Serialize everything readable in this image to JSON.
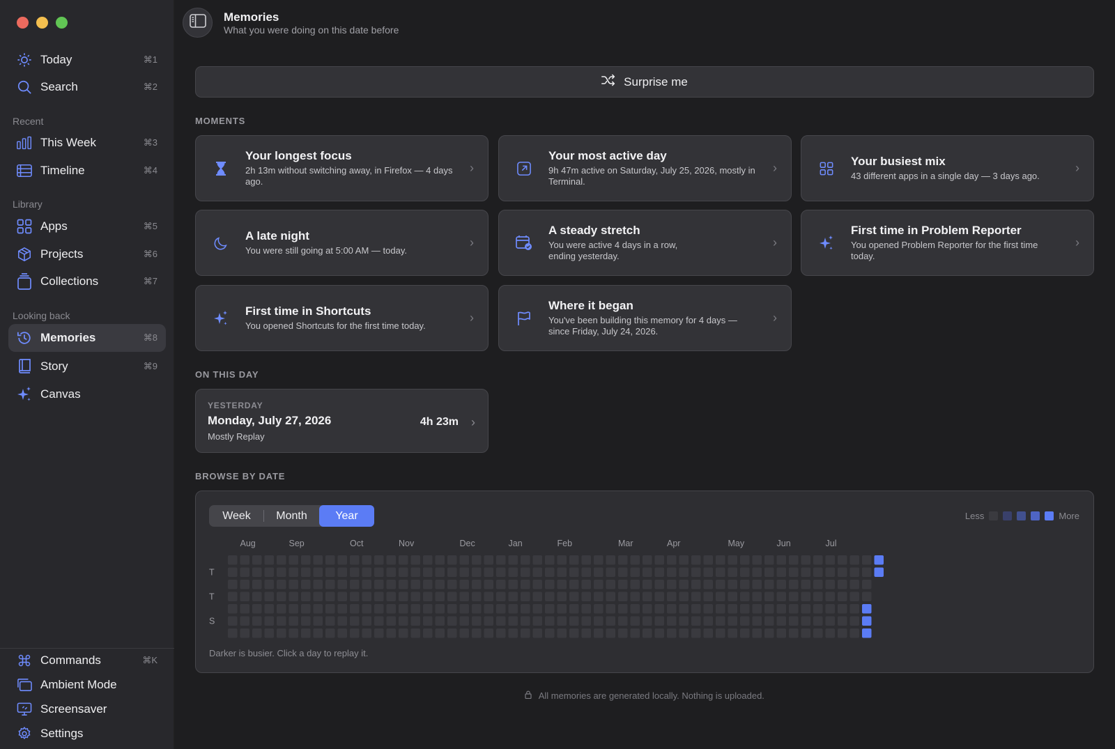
{
  "sidebar": {
    "nav_top": [
      {
        "label": "Today",
        "shortcut": "⌘1",
        "icon": "sun-icon"
      },
      {
        "label": "Search",
        "shortcut": "⌘2",
        "icon": "search-icon"
      }
    ],
    "recent_label": "Recent",
    "recent": [
      {
        "label": "This Week",
        "shortcut": "⌘3",
        "icon": "bar-chart-icon"
      },
      {
        "label": "Timeline",
        "shortcut": "⌘4",
        "icon": "timeline-icon"
      }
    ],
    "library_label": "Library",
    "library": [
      {
        "label": "Apps",
        "shortcut": "⌘5",
        "icon": "grid-icon"
      },
      {
        "label": "Projects",
        "shortcut": "⌘6",
        "icon": "box-icon"
      },
      {
        "label": "Collections",
        "shortcut": "⌘7",
        "icon": "stack-icon"
      }
    ],
    "looking_back_label": "Looking back",
    "looking_back": [
      {
        "label": "Memories",
        "shortcut": "⌘8",
        "icon": "history-icon",
        "active": true
      },
      {
        "label": "Story",
        "shortcut": "⌘9",
        "icon": "book-icon"
      },
      {
        "label": "Canvas",
        "shortcut": "",
        "icon": "sparkle-icon"
      }
    ],
    "bottom": [
      {
        "label": "Commands",
        "shortcut": "⌘K",
        "icon": "command-icon"
      },
      {
        "label": "Ambient Mode",
        "shortcut": "",
        "icon": "windows-icon"
      },
      {
        "label": "Screensaver",
        "shortcut": "",
        "icon": "monitor-icon"
      },
      {
        "label": "Settings",
        "shortcut": "",
        "icon": "gear-icon"
      }
    ]
  },
  "header": {
    "title": "Memories",
    "subtitle": "What you were doing on this date before"
  },
  "surprise_label": "Surprise me",
  "moments_header": "MOMENTS",
  "moments": [
    {
      "title": "Your longest focus",
      "desc": "2h 13m without switching away, in Firefox — 4 days ago.",
      "icon": "hourglass-icon"
    },
    {
      "title": "Your most active day",
      "desc": "9h 47m active on Saturday, July 25, 2026, mostly in Terminal.",
      "icon": "arrow-up-right-square-icon"
    },
    {
      "title": "Your busiest mix",
      "desc": "43 different apps in a single day — 3 days ago.",
      "icon": "grid-icon"
    },
    {
      "title": "A late night",
      "desc": "You were still going at 5:00 AM — today.",
      "icon": "moon-icon"
    },
    {
      "title": "A steady stretch",
      "desc": "You were active 4 days in a row, ending yesterday.",
      "icon": "calendar-check-icon"
    },
    {
      "title": "First time in Problem Reporter",
      "desc": "You opened Problem Reporter for the first time today.",
      "icon": "sparkle-icon"
    },
    {
      "title": "First time in Shortcuts",
      "desc": "You opened Shortcuts for the first time today.",
      "icon": "sparkle-icon"
    },
    {
      "title": "Where it began",
      "desc": "You've been building this memory for 4 days — since Friday, July 24, 2026.",
      "icon": "flag-icon"
    }
  ],
  "on_this_day_header": "ON THIS DAY",
  "on_this_day": {
    "kicker": "YESTERDAY",
    "date": "Monday, July 27, 2026",
    "duration": "4h 23m",
    "summary": "Mostly Replay"
  },
  "browse_header": "BROWSE BY DATE",
  "browse": {
    "segments": [
      "Week",
      "Month",
      "Year"
    ],
    "selected": "Year",
    "legend_less": "Less",
    "legend_more": "More",
    "months": [
      "Aug",
      "Sep",
      "Oct",
      "Nov",
      "Dec",
      "Jan",
      "Feb",
      "Mar",
      "Apr",
      "May",
      "Jun",
      "Jul"
    ],
    "weekday_labels": [
      "",
      "T",
      "",
      "T",
      "",
      "S",
      ""
    ],
    "note": "Darker is busier. Click a day to replay it.",
    "colors": {
      "empty": "#3a3a3f",
      "l1": "#39406a",
      "l2": "#41508f",
      "l3": "#4e64c4",
      "l4": "#5b7cf5"
    },
    "active_days": [
      {
        "week": 52,
        "day": 4,
        "level": 4
      },
      {
        "week": 52,
        "day": 5,
        "level": 4
      },
      {
        "week": 52,
        "day": 6,
        "level": 4
      },
      {
        "week": 53,
        "day": 0,
        "level": 4
      },
      {
        "week": 53,
        "day": 1,
        "level": 4
      }
    ]
  },
  "footer_note": "All memories are generated locally. Nothing is uploaded."
}
